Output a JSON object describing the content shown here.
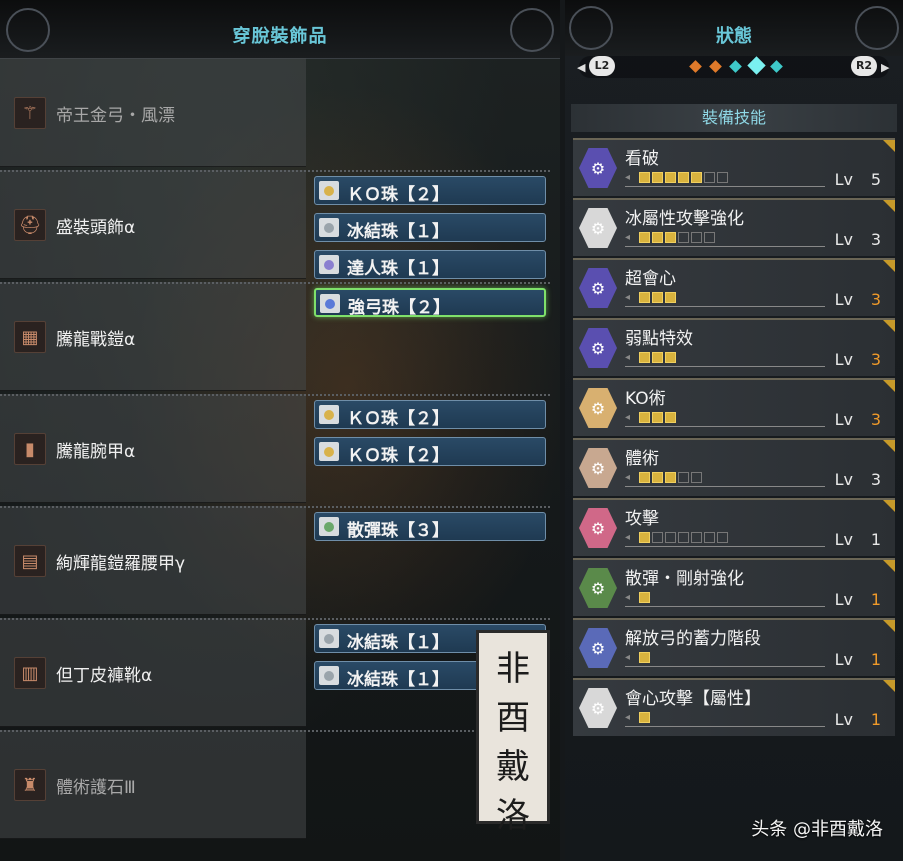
{
  "left_panel": {
    "title": "穿脫裝飾品",
    "equipment": [
      {
        "name": "帝王金弓・風漂",
        "icon": "bow-icon",
        "icon_glyph": "⚚",
        "dim": true,
        "decorations": []
      },
      {
        "name": "盛裝頭飾α",
        "icon": "helmet-icon",
        "icon_glyph": "⛑",
        "dim": false,
        "decorations": [
          {
            "name": "ＫＯ珠【２】",
            "icon": "gold-jewel-icon",
            "color": "#d8b24a",
            "selected": false
          },
          {
            "name": "冰結珠【１】",
            "icon": "gray-jewel-icon",
            "color": "#9aa4ab",
            "selected": false
          },
          {
            "name": "達人珠【１】",
            "icon": "purple-jewel-icon",
            "color": "#8a7fd0",
            "selected": false
          }
        ]
      },
      {
        "name": "騰龍戰鎧α",
        "icon": "chest-armor-icon",
        "icon_glyph": "▦",
        "dim": false,
        "decorations": [
          {
            "name": "強弓珠【２】",
            "icon": "blue-jewel-icon",
            "color": "#5a7ad8",
            "selected": true
          }
        ]
      },
      {
        "name": "騰龍腕甲α",
        "icon": "arm-armor-icon",
        "icon_glyph": "▮",
        "dim": false,
        "decorations": [
          {
            "name": "ＫＯ珠【２】",
            "icon": "gold-jewel-icon",
            "color": "#d8b24a",
            "selected": false
          },
          {
            "name": "ＫＯ珠【２】",
            "icon": "gold-jewel-icon",
            "color": "#d8b24a",
            "selected": false
          }
        ]
      },
      {
        "name": "絢輝龍鎧羅腰甲γ",
        "icon": "waist-armor-icon",
        "icon_glyph": "▤",
        "dim": false,
        "decorations": [
          {
            "name": "散彈珠【３】",
            "icon": "green-jewel-icon",
            "color": "#6aa86a",
            "selected": false
          }
        ]
      },
      {
        "name": "但丁皮褲靴α",
        "icon": "leg-armor-icon",
        "icon_glyph": "▥",
        "dim": false,
        "decorations": [
          {
            "name": "冰結珠【１】",
            "icon": "gray-jewel-icon",
            "color": "#9aa4ab",
            "selected": false
          },
          {
            "name": "冰結珠【１】",
            "icon": "gray-jewel-icon",
            "color": "#9aa4ab",
            "selected": false
          }
        ]
      },
      {
        "name": "體術護石Ⅲ",
        "icon": "charm-icon",
        "icon_glyph": "♜",
        "dim": true,
        "decorations": []
      }
    ],
    "stamp_chars": [
      "非",
      "酉",
      "戴",
      "洛"
    ]
  },
  "right_panel": {
    "title": "狀態",
    "left_button": "L2",
    "right_button": "R2",
    "skills_header": "裝備技能",
    "skills": [
      {
        "name": "看破",
        "lv_label": "Lv",
        "level": "5",
        "max": 7,
        "filled": 5,
        "icon_color": "#5a4fb0",
        "level_color": "#e8e8e8"
      },
      {
        "name": "冰屬性攻擊強化",
        "lv_label": "Lv",
        "level": "3",
        "max": 6,
        "filled": 3,
        "icon_color": "#d8d8d8",
        "level_color": "#e8e8e8"
      },
      {
        "name": "超會心",
        "lv_label": "Lv",
        "level": "3",
        "max": 3,
        "filled": 3,
        "icon_color": "#5a4fb0",
        "level_color": "#f09a2a"
      },
      {
        "name": "弱點特效",
        "lv_label": "Lv",
        "level": "3",
        "max": 3,
        "filled": 3,
        "icon_color": "#5a4fb0",
        "level_color": "#f09a2a"
      },
      {
        "name": "KO術",
        "lv_label": "Lv",
        "level": "3",
        "max": 3,
        "filled": 3,
        "icon_color": "#d8b070",
        "level_color": "#f09a2a"
      },
      {
        "name": "體術",
        "lv_label": "Lv",
        "level": "3",
        "max": 5,
        "filled": 3,
        "icon_color": "#c8a890",
        "level_color": "#e8e8e8"
      },
      {
        "name": "攻擊",
        "lv_label": "Lv",
        "level": "1",
        "max": 7,
        "filled": 1,
        "icon_color": "#d06888",
        "level_color": "#e8e8e8"
      },
      {
        "name": "散彈・剛射強化",
        "lv_label": "Lv",
        "level": "1",
        "max": 1,
        "filled": 1,
        "icon_color": "#5a8a4a",
        "level_color": "#f09a2a"
      },
      {
        "name": "解放弓的蓄力階段",
        "lv_label": "Lv",
        "level": "1",
        "max": 1,
        "filled": 1,
        "icon_color": "#5a6ab8",
        "level_color": "#f09a2a"
      },
      {
        "name": "會心攻擊【屬性】",
        "lv_label": "Lv",
        "level": "1",
        "max": 1,
        "filled": 1,
        "icon_color": "#d8d8d8",
        "level_color": "#f09a2a"
      }
    ]
  },
  "watermark": "头条 @非酉戴洛"
}
